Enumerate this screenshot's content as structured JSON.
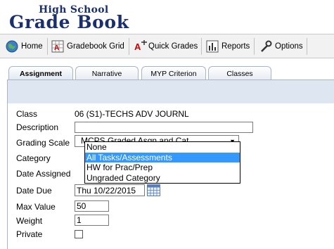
{
  "header": {
    "line1": "High School",
    "line2": "Grade Book"
  },
  "toolbar": {
    "home": "Home",
    "gradebook_grid": "Gradebook Grid",
    "quick_grades": "Quick Grades",
    "reports": "Reports",
    "options": "Options"
  },
  "tabs": [
    "Assignment",
    "Narrative",
    "MYP Criterion",
    "Classes"
  ],
  "form": {
    "class_label": "Class",
    "class_value": "06 (S1)-TECHS ADV JOURNL",
    "description_label": "Description",
    "description_value": "",
    "grading_scale_label": "Grading Scale",
    "grading_scale_value": "MCPS Graded Asgn and Cat",
    "category_label": "Category",
    "date_assigned_label": "Date Assigned",
    "date_due_label": "Date Due",
    "date_due_value": "Thu 10/22/2015",
    "max_value_label": "Max Value",
    "max_value": "50",
    "weight_label": "Weight",
    "weight_value": "1",
    "private_label": "Private",
    "private_checked": false
  },
  "category_dropdown": {
    "options": [
      "None",
      "All Tasks/Assessments",
      "HW for Prac/Prep",
      "Ungraded Category"
    ],
    "selected_index": 1
  },
  "colors": {
    "brand": "#1a2f6e",
    "highlight": "#3399ff",
    "panel_band": "#dde6f1"
  }
}
